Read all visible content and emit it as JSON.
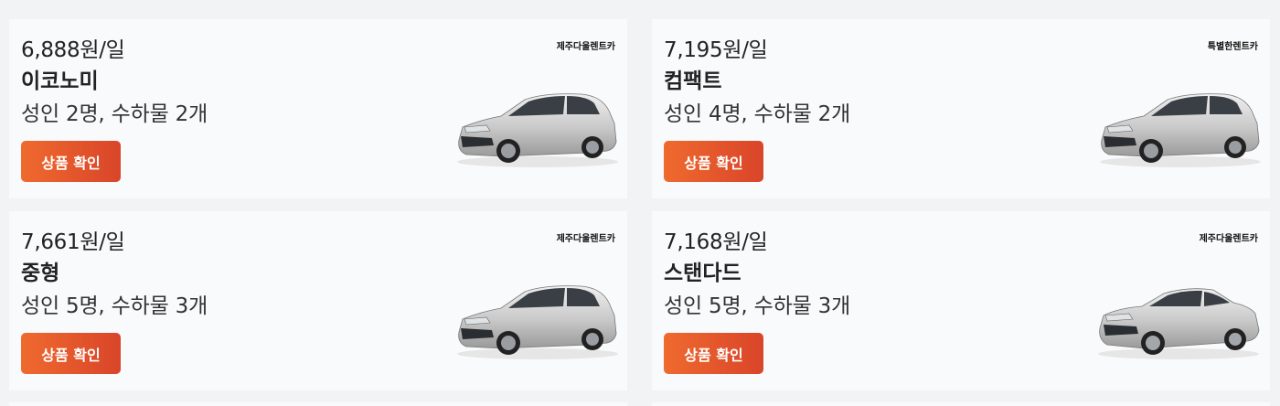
{
  "cards": [
    {
      "price": "6,888원/일",
      "name": "이코노미",
      "capacity": "성인 2명, 수하물 2개",
      "button": "상품 확인",
      "vendor": "제주다울렌트카",
      "car_icon": "hatchback-car-image"
    },
    {
      "price": "7,195원/일",
      "name": "컴팩트",
      "capacity": "성인 4명, 수하물 2개",
      "button": "상품 확인",
      "vendor": "특별한렌트카",
      "car_icon": "hatchback-car-image"
    },
    {
      "price": "7,661원/일",
      "name": "중형",
      "capacity": "성인 5명, 수하물 3개",
      "button": "상품 확인",
      "vendor": "제주다울렌트카",
      "car_icon": "hatchback-car-image"
    },
    {
      "price": "7,168원/일",
      "name": "스탠다드",
      "capacity": "성인 5명, 수하물 3개",
      "button": "상품 확인",
      "vendor": "제주다울렌트카",
      "car_icon": "sedan-car-image"
    }
  ],
  "colors": {
    "button_start": "#ef6a2e",
    "button_end": "#d9452a",
    "card_bg": "#f9fafb",
    "page_bg": "#f2f3f5"
  }
}
